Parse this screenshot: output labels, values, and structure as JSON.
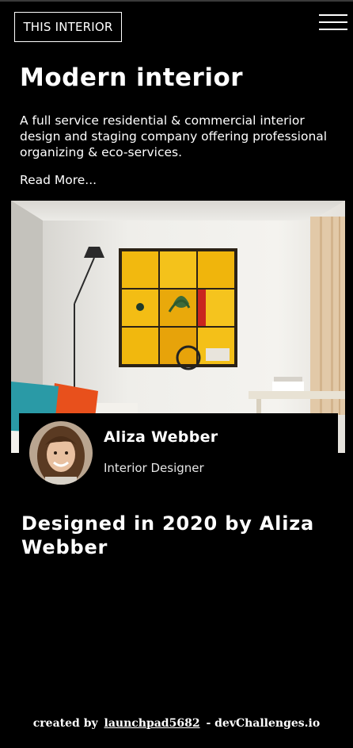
{
  "header": {
    "logo_text": "THIS INTERIOR",
    "menu_icon": "hamburger-menu-icon"
  },
  "hero": {
    "title": "Modern interior",
    "description": "A full service residential & commercial interior design and staging company offering professional organizing & eco-services.",
    "read_more": "Read More..."
  },
  "author": {
    "name": "Aliza Webber",
    "role": "Interior Designer"
  },
  "designed_note": "Designed in 2020 by Aliza Webber",
  "footer": {
    "prefix": "created by",
    "username": "launchpad5682",
    "suffix": "- devChallenges.io"
  },
  "colors": {
    "background": "#000000",
    "text": "#ffffff",
    "art_yellow": "#f2b90f",
    "sofa_orange": "#e8501c",
    "sofa_teal": "#2a9aa6"
  }
}
